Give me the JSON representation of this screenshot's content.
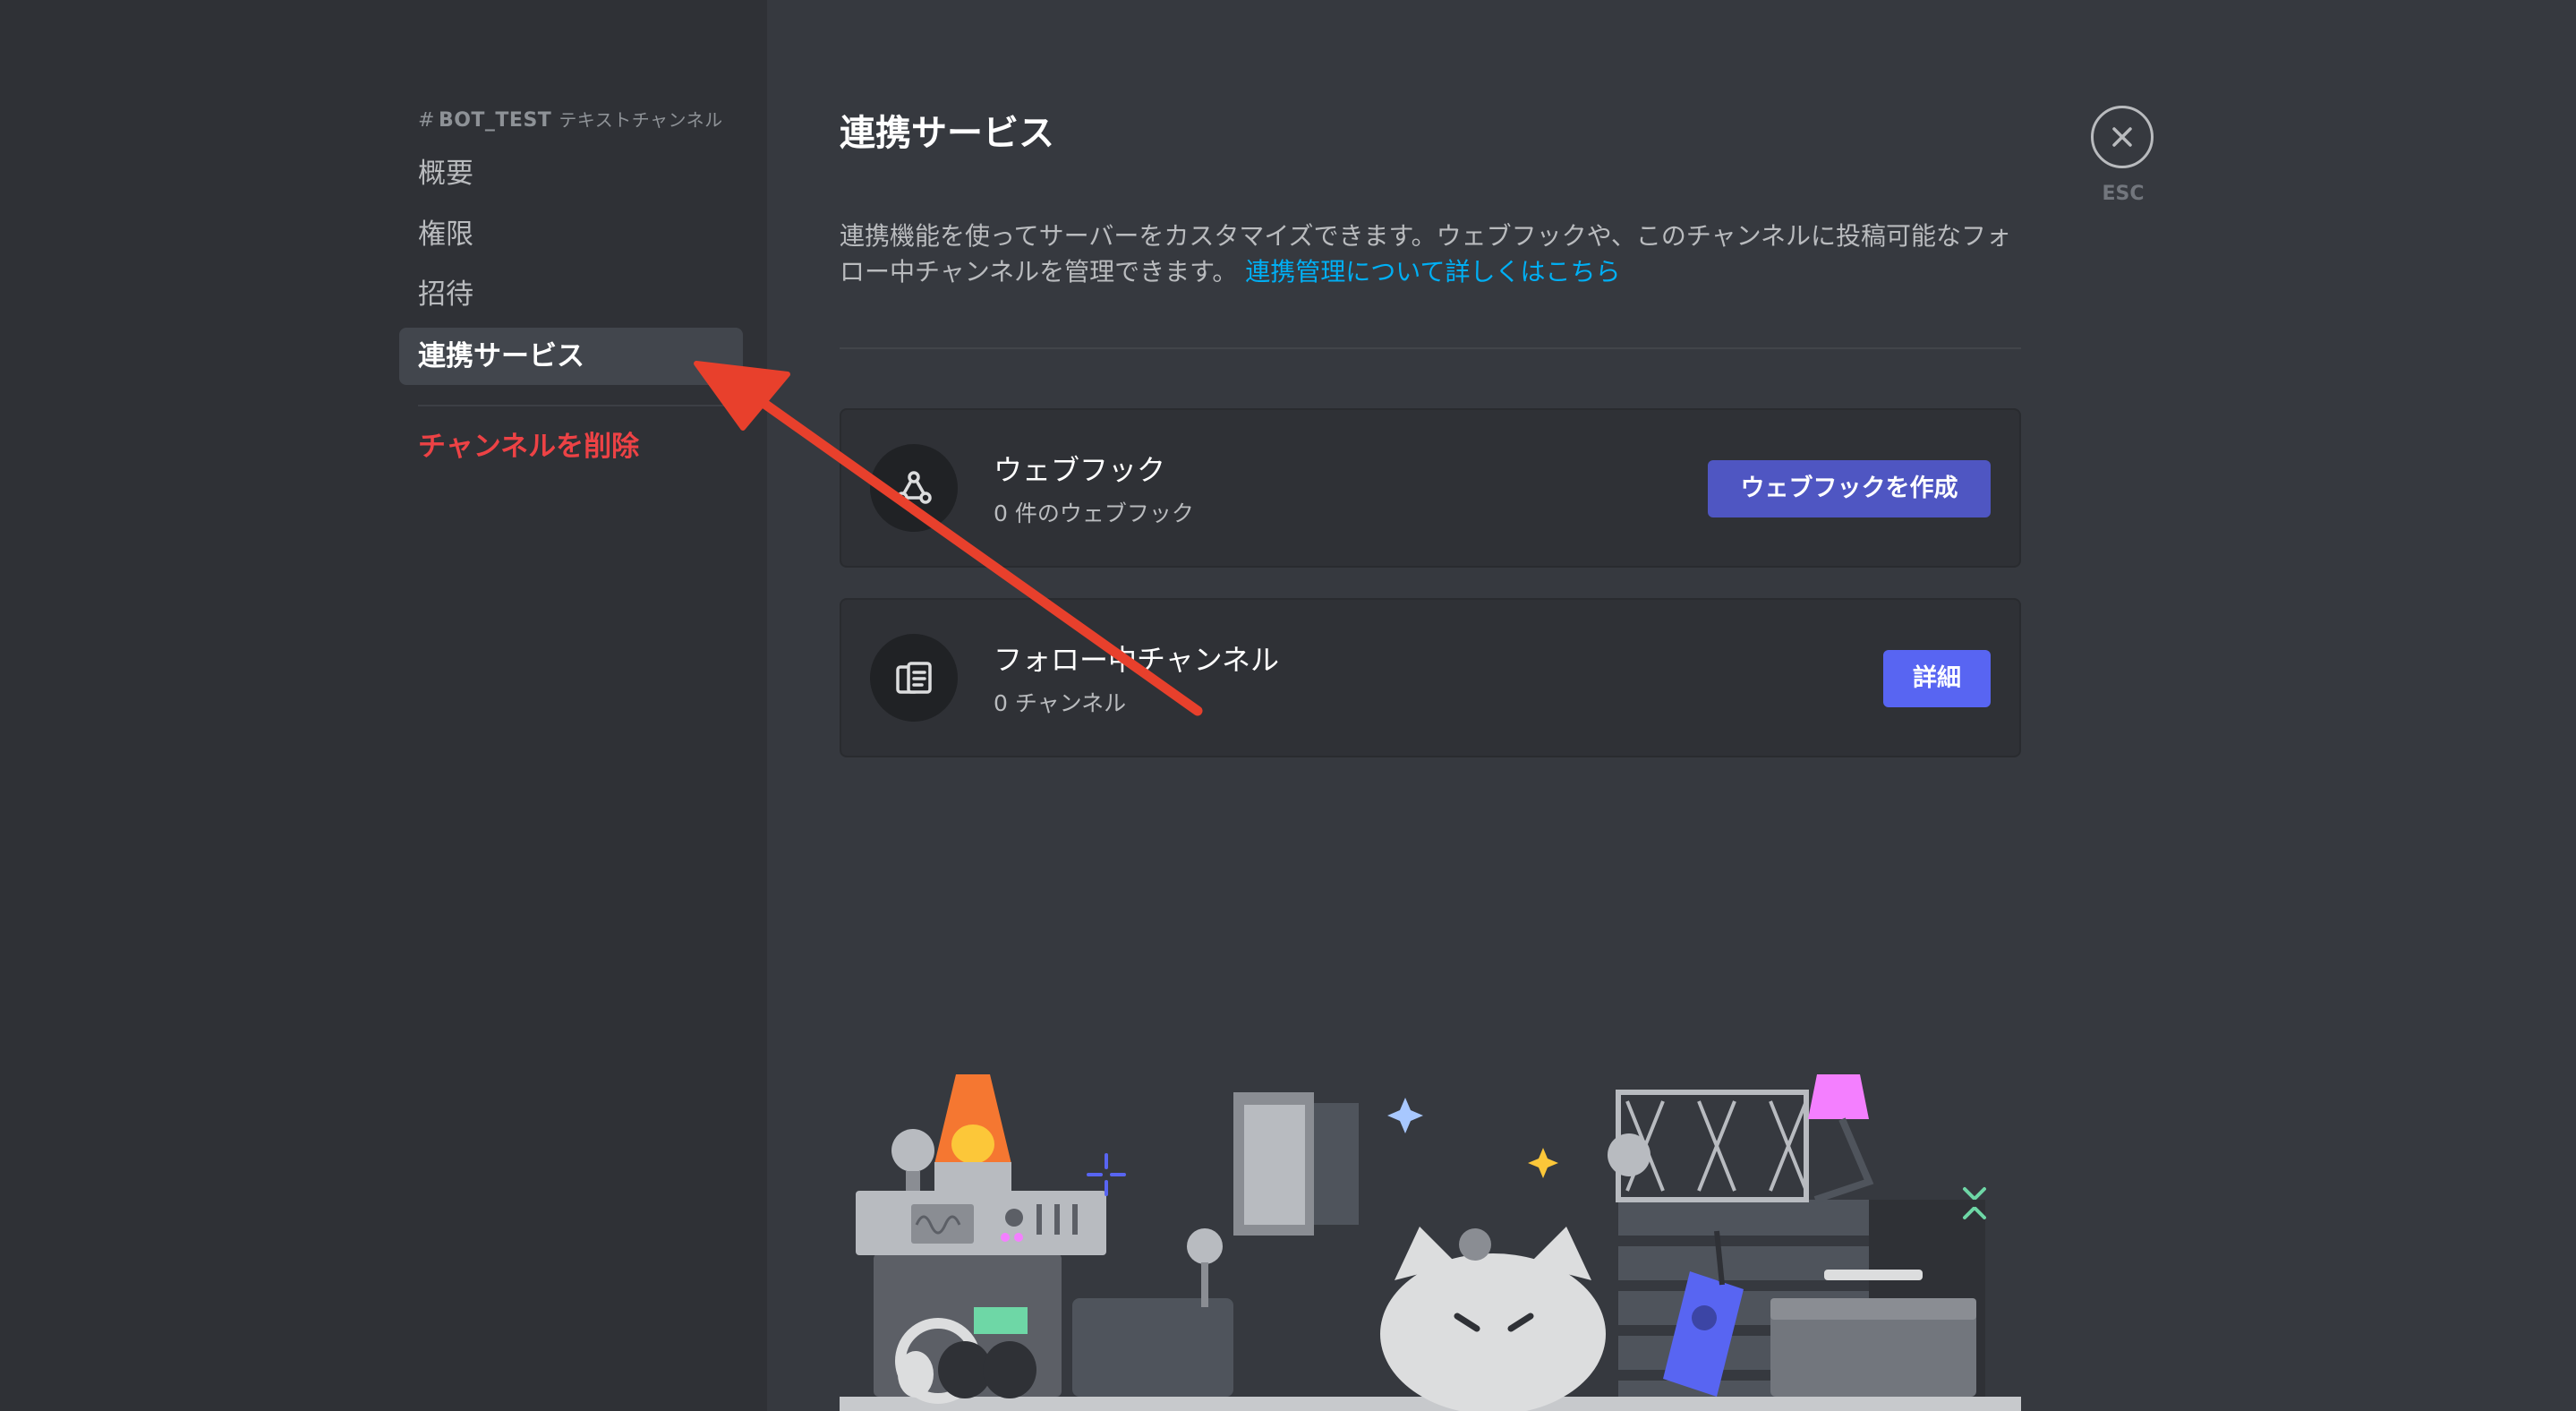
{
  "sidebar": {
    "header": {
      "hash": "#",
      "channel": "BOT_TEST",
      "type": "テキストチャンネル"
    },
    "items": [
      {
        "label": "概要"
      },
      {
        "label": "権限"
      },
      {
        "label": "招待"
      },
      {
        "label": "連携サービス"
      }
    ],
    "delete_label": "チャンネルを削除"
  },
  "main": {
    "title": "連携サービス",
    "description": "連携機能を使ってサーバーをカスタマイズできます。ウェブフックや、このチャンネルに投稿可能なフォロー中チャンネルを管理できます。",
    "link": "連携管理について詳しくはこちら",
    "cards": [
      {
        "icon": "webhook-icon",
        "title": "ウェブフック",
        "subtitle": "0 件のウェブフック",
        "button": "ウェブフックを作成"
      },
      {
        "icon": "followed-channel-icon",
        "title": "フォロー中チャンネル",
        "subtitle": "0 チャンネル",
        "button": "詳細"
      }
    ]
  },
  "close": {
    "esc_label": "ESC"
  },
  "colors": {
    "background": "#36393f",
    "sidebar": "#2f3136",
    "accent": "#5865f2",
    "danger": "#ed4245",
    "link": "#00aff4",
    "annotation_arrow": "#e8402c"
  }
}
